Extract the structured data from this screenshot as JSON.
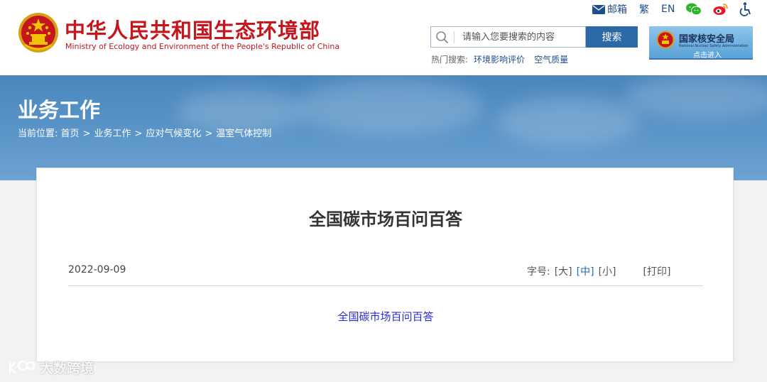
{
  "header": {
    "site_title": "中华人民共和国生态环境部",
    "site_subtitle": "Ministry of Ecology and Environment of the People's Republic of China",
    "top_links": {
      "mail": "邮箱",
      "traditional": "繁",
      "english": "EN"
    },
    "search": {
      "placeholder": "请输入您要搜索的内容",
      "button": "搜索"
    },
    "hot_search": {
      "label": "热门搜索:",
      "items": [
        "环境影响评价",
        "空气质量"
      ]
    },
    "nsa": {
      "name": "国家核安全局",
      "english": "National Nuclear Safety Administration",
      "enter": "点击进入"
    }
  },
  "banner": {
    "title": "业务工作",
    "breadcrumb": {
      "label": "当前位置:",
      "items": [
        "首页",
        "业务工作",
        "应对气候变化",
        "温室气体控制"
      ],
      "separator": ">"
    }
  },
  "article": {
    "title": "全国碳市场百问百答",
    "date": "2022-09-09",
    "font_size": {
      "label": "字号:",
      "large": "[大]",
      "medium": "[中]",
      "small": "[小]",
      "print": "[打印]"
    },
    "attachment_link": "全国碳市场百问百答"
  },
  "watermark": {
    "text": "大数跨境"
  },
  "colors": {
    "brand_red": "#c4161c",
    "link_blue": "#1f4e8c",
    "button_blue": "#2b6aa6",
    "banner_blue": "#4a86bd"
  }
}
